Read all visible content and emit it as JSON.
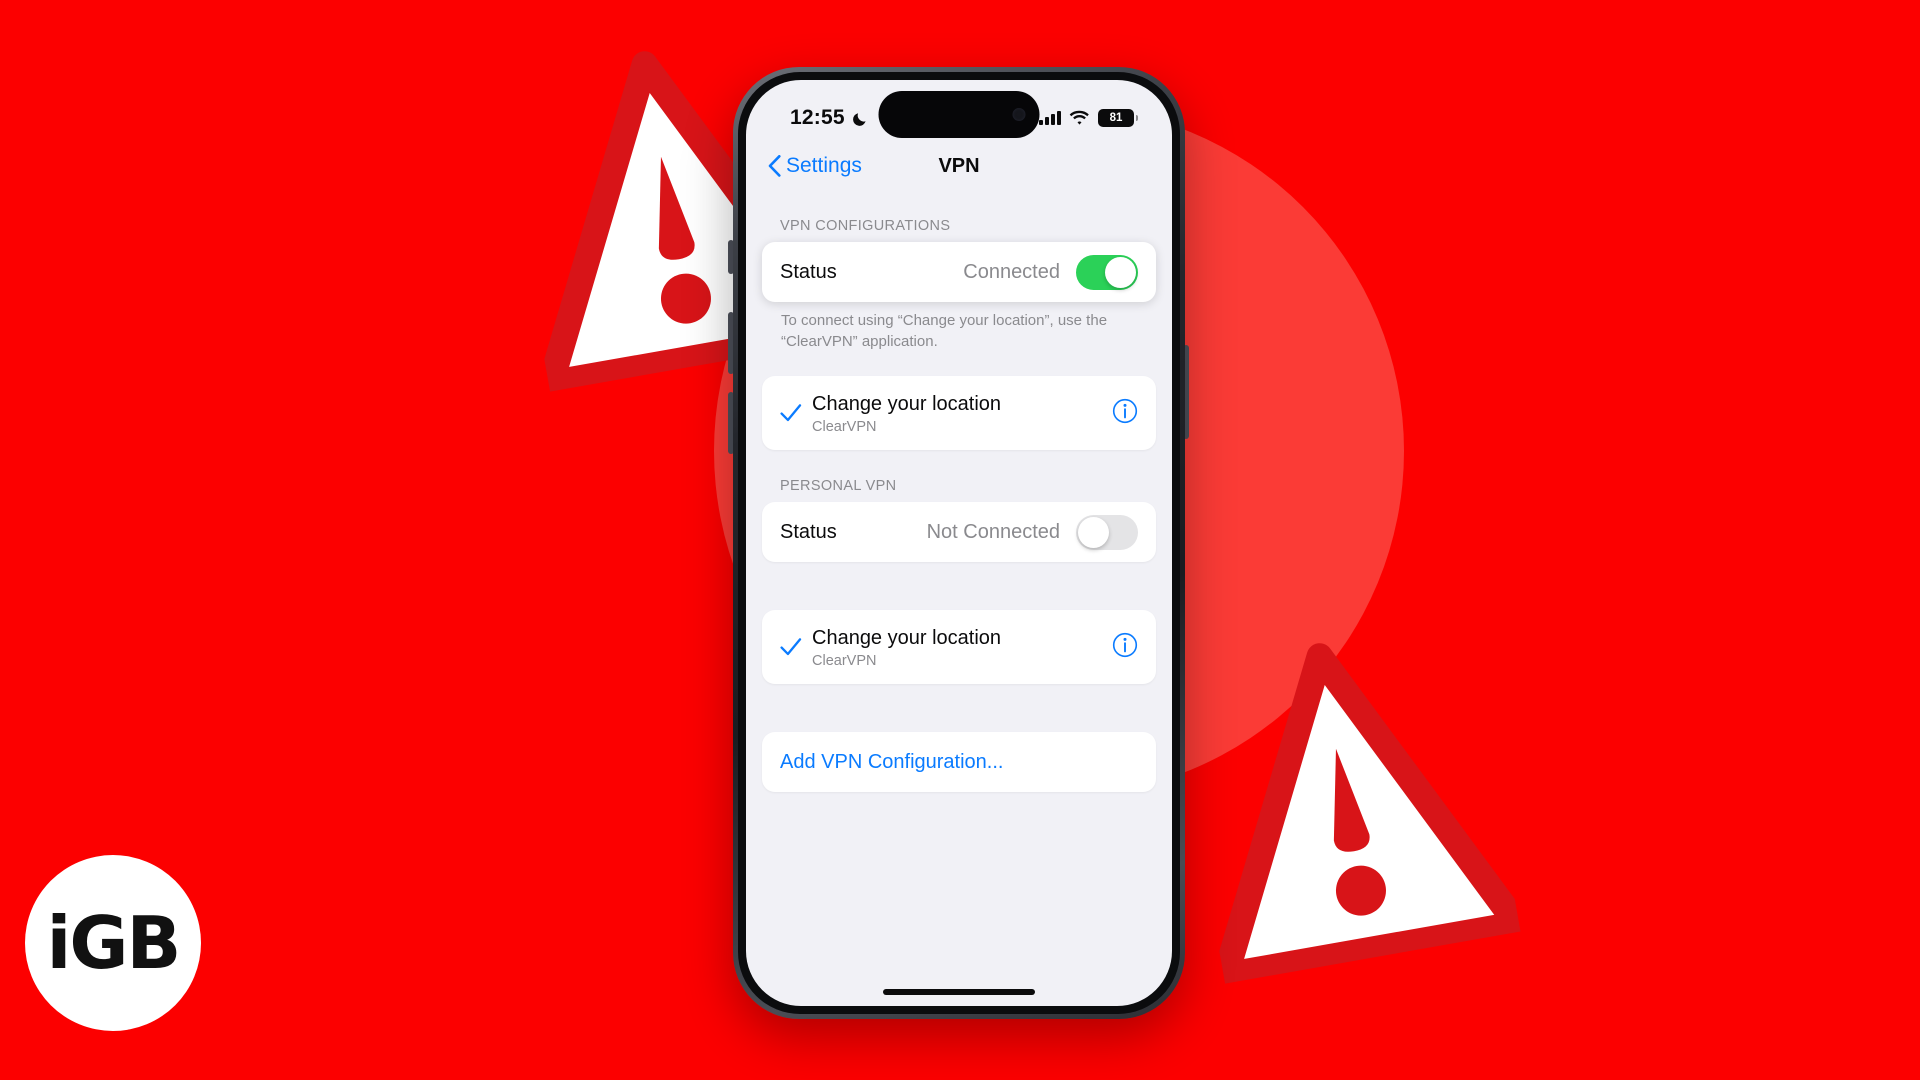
{
  "branding": {
    "logo_text": "iGB"
  },
  "status_bar": {
    "time": "12:55",
    "dnd_icon": "crescent-moon-icon",
    "cellular_icon": "cellular-bars-icon",
    "wifi_icon": "wifi-icon",
    "battery_level": "81"
  },
  "nav": {
    "back_label": "Settings",
    "back_icon": "chevron-left-icon",
    "title": "VPN"
  },
  "sections": [
    {
      "header": "VPN CONFIGURATIONS",
      "status_row": {
        "label": "Status",
        "value": "Connected",
        "toggle_state": "on"
      },
      "footnote": "To connect using “Change your location”, use the “ClearVPN” application.",
      "config": {
        "title": "Change your location",
        "subtitle": "ClearVPN",
        "selected": true,
        "check_icon": "checkmark-icon",
        "info_icon": "info-circle-icon"
      }
    },
    {
      "header": "PERSONAL VPN",
      "status_row": {
        "label": "Status",
        "value": "Not Connected",
        "toggle_state": "off"
      },
      "config": {
        "title": "Change your location",
        "subtitle": "ClearVPN",
        "selected": true,
        "check_icon": "checkmark-icon",
        "info_icon": "info-circle-icon"
      }
    }
  ],
  "add_config": {
    "label": "Add VPN Configuration..."
  },
  "colors": {
    "background": "#FC0000",
    "background_circle": "#FB3B36",
    "accent_blue": "#0A7BFF",
    "toggle_on": "#2BD158",
    "toggle_off": "#E4E4E6",
    "screen_bg": "#F1F1F6",
    "secondary_text": "#8A8A8E"
  }
}
